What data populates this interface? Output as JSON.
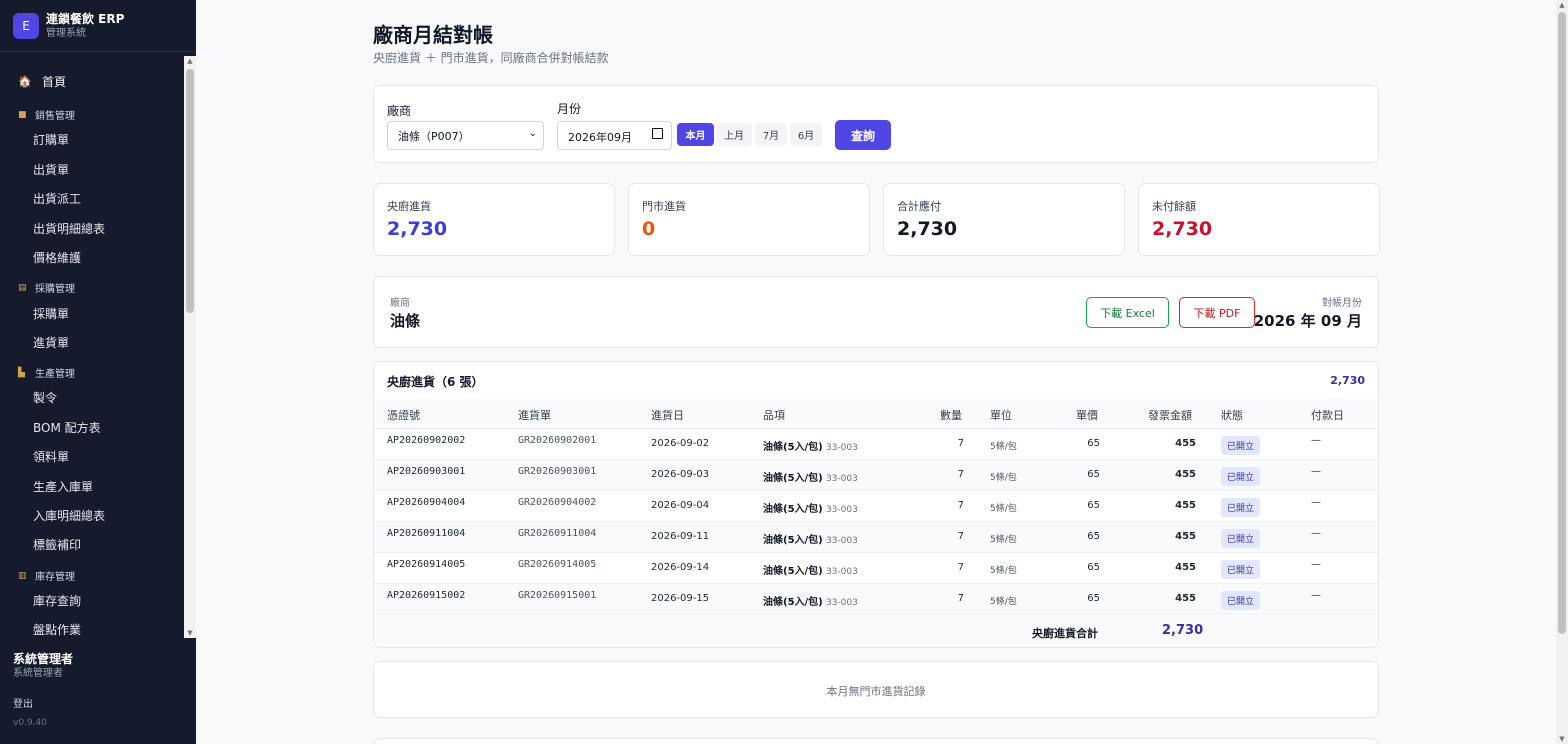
{
  "app": {
    "logo_letter": "E",
    "title": "連鎖餐飲 ERP",
    "subtitle": "管理系統"
  },
  "sidebar": {
    "home": {
      "icon": "house-icon",
      "label": "首頁"
    },
    "groups": [
      {
        "icon": "box-icon",
        "label": "銷售管理",
        "items": [
          "訂購單",
          "出貨單",
          "出貨派工",
          "出貨明細總表",
          "價格維護"
        ]
      },
      {
        "icon": "cart-icon",
        "label": "採購管理",
        "items": [
          "採購單",
          "進貨單"
        ]
      },
      {
        "icon": "factory-icon",
        "label": "生產管理",
        "items": [
          "製令",
          "BOM 配方表",
          "領料單",
          "生產入庫單",
          "入庫明細總表",
          "標籤補印"
        ]
      },
      {
        "icon": "warehouse-icon",
        "label": "庫存管理",
        "items": [
          "庫存查詢",
          "盤點作業"
        ]
      }
    ],
    "user": {
      "name": "系統管理者",
      "role": "系統管理者"
    },
    "logout": "登出",
    "version": "v0.9.40"
  },
  "page": {
    "title": "廠商月結對帳",
    "subtitle": "央廚進貨 ＋ 門市進貨，同廠商合併對帳結款"
  },
  "filter": {
    "vendor_label": "廠商",
    "vendor_value": "油條（P007）",
    "month_label": "月份",
    "month_value": "2026年09月",
    "chips": [
      {
        "label": "本月",
        "active": true
      },
      {
        "label": "上月",
        "active": false
      },
      {
        "label": "7月",
        "active": false
      },
      {
        "label": "6月",
        "active": false
      }
    ],
    "query_button": "查詢"
  },
  "stats": [
    {
      "label": "央廚進貨",
      "value": "2,730",
      "color": "#3b3fcf"
    },
    {
      "label": "門市進貨",
      "value": "0",
      "color": "#ea580c"
    },
    {
      "label": "合計應付",
      "value": "2,730",
      "color": "#111827"
    },
    {
      "label": "未付餘額",
      "value": "2,730",
      "color": "#c8102e"
    }
  ],
  "vendor_card": {
    "label": "廠商",
    "name": "油條",
    "excel_button": "下載 Excel",
    "pdf_button": "下載 PDF",
    "period_label": "對帳月份",
    "period_value": "2026 年 09 月"
  },
  "central": {
    "title": "央廚進貨（6 張）",
    "total": "2,730",
    "columns": [
      "憑證號",
      "進貨單",
      "進貨日",
      "品項",
      "數量",
      "單位",
      "單價",
      "發票金額",
      "狀態",
      "付款日"
    ],
    "rows": [
      {
        "voucher": "AP20260902002",
        "receipt": "GR20260902001",
        "date": "2026-09-02",
        "item": "油條(5入/包)",
        "code": "33-003",
        "qty": "7",
        "unit": "5條/包",
        "price": "65",
        "amount": "455",
        "status": "已開立",
        "paid": "—"
      },
      {
        "voucher": "AP20260903001",
        "receipt": "GR20260903001",
        "date": "2026-09-03",
        "item": "油條(5入/包)",
        "code": "33-003",
        "qty": "7",
        "unit": "5條/包",
        "price": "65",
        "amount": "455",
        "status": "已開立",
        "paid": "—"
      },
      {
        "voucher": "AP20260904004",
        "receipt": "GR20260904002",
        "date": "2026-09-04",
        "item": "油條(5入/包)",
        "code": "33-003",
        "qty": "7",
        "unit": "5條/包",
        "price": "65",
        "amount": "455",
        "status": "已開立",
        "paid": "—"
      },
      {
        "voucher": "AP20260911004",
        "receipt": "GR20260911004",
        "date": "2026-09-11",
        "item": "油條(5入/包)",
        "code": "33-003",
        "qty": "7",
        "unit": "5條/包",
        "price": "65",
        "amount": "455",
        "status": "已開立",
        "paid": "—"
      },
      {
        "voucher": "AP20260914005",
        "receipt": "GR20260914005",
        "date": "2026-09-14",
        "item": "油條(5入/包)",
        "code": "33-003",
        "qty": "7",
        "unit": "5條/包",
        "price": "65",
        "amount": "455",
        "status": "已開立",
        "paid": "—"
      },
      {
        "voucher": "AP20260915002",
        "receipt": "GR20260915001",
        "date": "2026-09-15",
        "item": "油條(5入/包)",
        "code": "33-003",
        "qty": "7",
        "unit": "5條/包",
        "price": "65",
        "amount": "455",
        "status": "已開立",
        "paid": "—"
      }
    ],
    "footer_label": "央廚進貨合計",
    "footer_total": "2,730"
  },
  "store": {
    "empty_text": "本月無門市進貨記錄"
  }
}
